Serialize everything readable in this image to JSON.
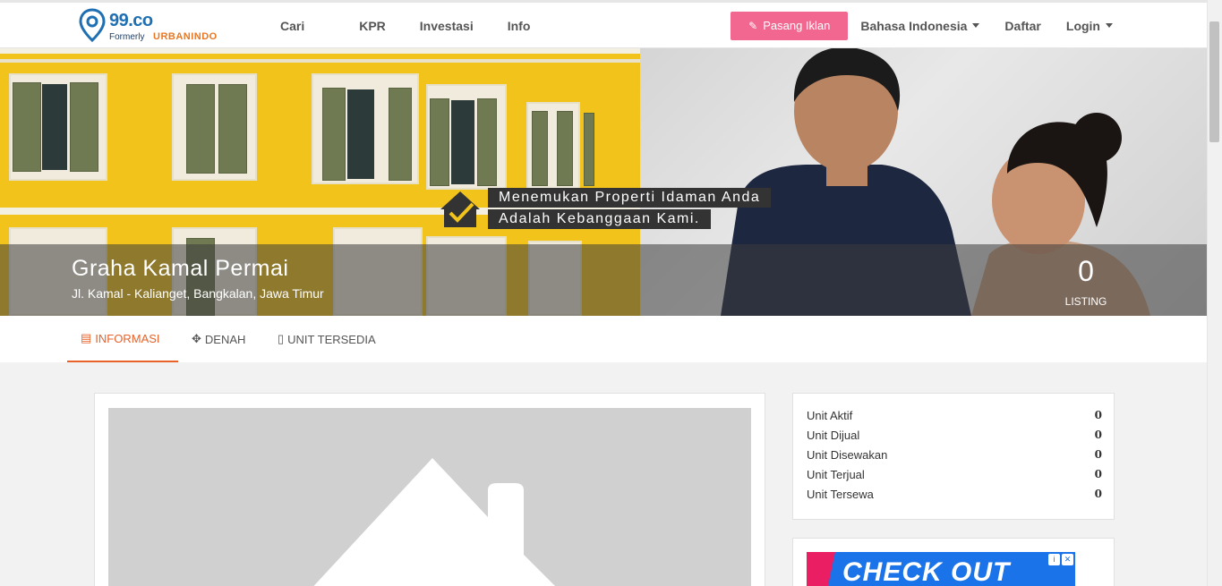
{
  "navbar": {
    "logo_text": "99.co",
    "logo_formerly": "Formerly",
    "logo_urban": "URBANINDO",
    "links": [
      "Cari",
      "KPR",
      "Investasi",
      "Info"
    ],
    "pasang_iklan": "Pasang Iklan",
    "language": "Bahasa Indonesia",
    "daftar": "Daftar",
    "login": "Login"
  },
  "hero": {
    "tagline_1": "Menemukan Properti Idaman Anda",
    "tagline_2": "Adalah Kebanggaan Kami.",
    "title": "Graha Kamal Permai",
    "address": "Jl. Kamal - Kalianget, Bangkalan, Jawa Timur",
    "listing_count": "0",
    "listing_label": "LISTING"
  },
  "tabs": [
    {
      "label": "INFORMASI",
      "active": true
    },
    {
      "label": "DENAH",
      "active": false
    },
    {
      "label": "UNIT TERSEDIA",
      "active": false
    }
  ],
  "stats": [
    {
      "label": "Unit Aktif",
      "value": "0"
    },
    {
      "label": "Unit Dijual",
      "value": "0"
    },
    {
      "label": "Unit Disewakan",
      "value": "0"
    },
    {
      "label": "Unit Terjual",
      "value": "0"
    },
    {
      "label": "Unit Tersewa",
      "value": "0"
    }
  ],
  "ad": {
    "text": "CHECK OUT"
  },
  "colors": {
    "accent": "#e8622a",
    "pasang_button": "#f2678f",
    "brand_blue": "#1f6fb2",
    "brand_orange": "#e87722"
  }
}
